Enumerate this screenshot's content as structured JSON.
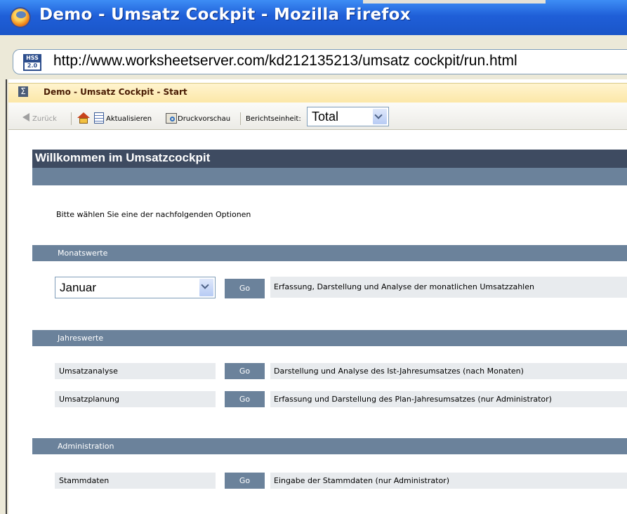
{
  "window": {
    "title": "Demo -  Umsatz Cockpit - Mozilla Firefox"
  },
  "address_bar": {
    "site_icon_top": "HSS",
    "site_icon_bottom": "2.0",
    "url": "http://www.worksheetserver.com/kd212135213/umsatz cockpit/run.html"
  },
  "app_bar": {
    "icon": "Σ",
    "title": "Demo -  Umsatz Cockpit -  Start"
  },
  "toolbar": {
    "back_label": "Zurück",
    "refresh_label": "Aktualisieren",
    "print_preview_label": "Druckvorschau",
    "report_unit_label": "Berichtseinheit:",
    "report_unit_value": "Total"
  },
  "page": {
    "title": "Willkommen im Umsatzcockpit",
    "instruction": "Bitte wählen Sie eine der nachfolgenden Optionen"
  },
  "sections": {
    "monthly": {
      "header": "Monatswerte",
      "month_select_value": "Januar",
      "go_label": "Go",
      "description": "Erfassung, Darstellung und Analyse der monatlichen Umsatzzahlen"
    },
    "yearly": {
      "header": "Jahreswerte",
      "rows": [
        {
          "label": "Umsatzanalyse",
          "go_label": "Go",
          "description": "Darstellung und Analyse des Ist-Jahresumsatzes (nach Monaten)"
        },
        {
          "label": "Umsatzplanung",
          "go_label": "Go",
          "description": "Erfassung und Darstellung des Plan-Jahresumsatzes (nur Administrator)"
        }
      ]
    },
    "admin": {
      "header": "Administration",
      "rows": [
        {
          "label": "Stammdaten",
          "go_label": "Go",
          "description": "Eingabe der Stammdaten (nur Administrator)"
        }
      ]
    }
  },
  "colors": {
    "title_band": "#3e4b61",
    "section_band": "#6b829b",
    "row_background": "#e8ebee",
    "window_titlebar": "#1f5fd8"
  }
}
